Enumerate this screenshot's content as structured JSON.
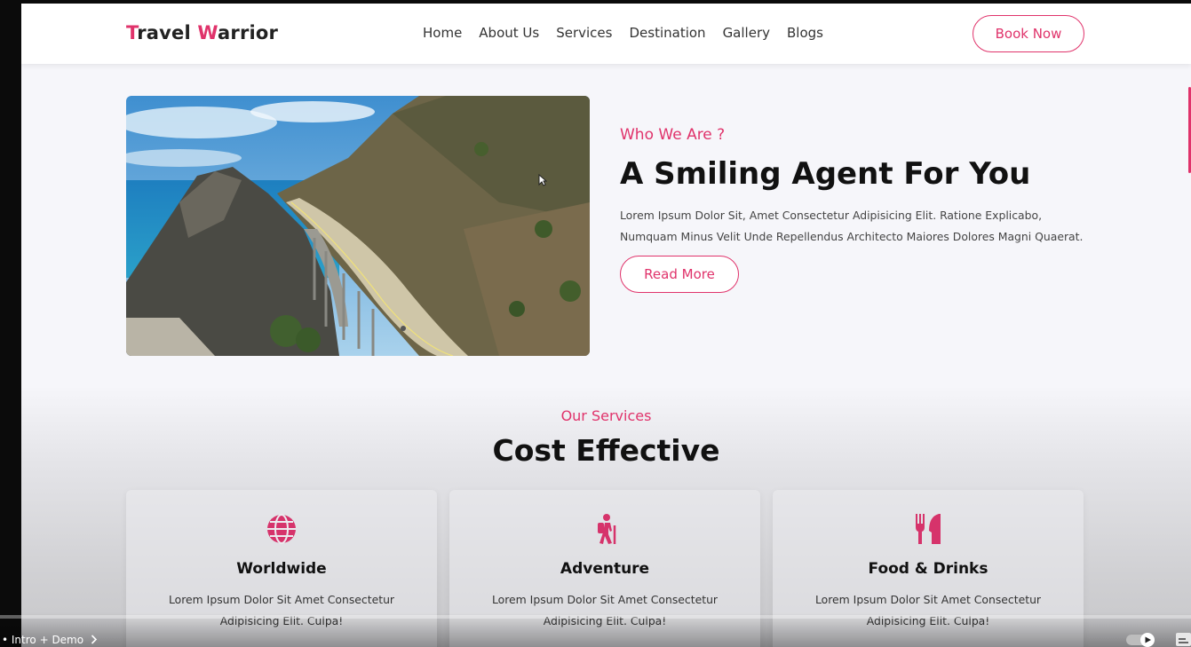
{
  "brand": {
    "first": "T",
    "first_rest": "ravel ",
    "second": "W",
    "second_rest": "arrior",
    "accent_color": "#e0336b"
  },
  "nav": {
    "items": [
      "Home",
      "About Us",
      "Services",
      "Destination",
      "Gallery",
      "Blogs"
    ],
    "book_label": "Book Now"
  },
  "hero": {
    "image_icon": "coastal-bridge-photo",
    "eyebrow": "Who We Are ?",
    "title": "A Smiling Agent For You",
    "description": "Lorem Ipsum Dolor Sit, Amet Consectetur Adipisicing Elit. Ratione Explicabo, Numquam Minus Velit Unde Repellendus Architecto Maiores Dolores Magni Quaerat.",
    "read_more_label": "Read More"
  },
  "services": {
    "eyebrow": "Our Services",
    "title": "Cost Effective",
    "cards": [
      {
        "icon": "globe-icon",
        "title": "Worldwide",
        "text": "Lorem Ipsum Dolor Sit Amet Consectetur Adipisicing Elit. Culpa!"
      },
      {
        "icon": "hiker-icon",
        "title": "Adventure",
        "text": "Lorem Ipsum Dolor Sit Amet Consectetur Adipisicing Elit. Culpa!"
      },
      {
        "icon": "utensils-icon",
        "title": "Food & Drinks",
        "text": "Lorem Ipsum Dolor Sit Amet Consectetur Adipisicing Elit. Culpa!"
      }
    ]
  },
  "video_player": {
    "chapter_label": "• Intro + Demo"
  }
}
